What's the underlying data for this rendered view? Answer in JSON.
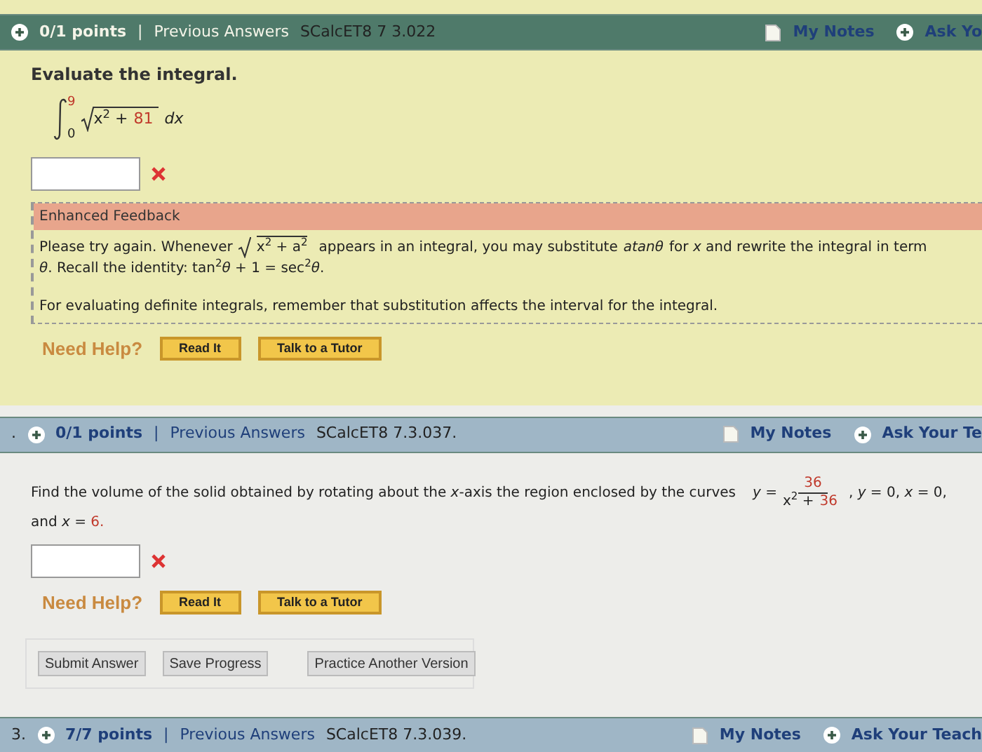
{
  "questions": [
    {
      "header": {
        "points": "0/1 points",
        "separator": "|",
        "previous": "Previous Answers",
        "code": "SCalcET8 7 3.022",
        "notes": "My Notes",
        "ask": "Ask Yo"
      },
      "kind": "feedback",
      "prompt": "Evaluate the integral.",
      "integral": {
        "upper": "9",
        "lower": "0",
        "radicand": [
          {
            "text": "x$^{2}$ +",
            "highlight": false
          },
          {
            "text": "81",
            "highlight": true
          }
        ],
        "differential": "dx"
      },
      "answer": {
        "incorrect": true
      },
      "feedback": {
        "title": "Enhanced Feedback",
        "line1_before": "Please try again. Whenever",
        "radical": "x$^{2}$ + a$^{2}$",
        "line1_mid": "appears in an integral, you may substitute",
        "substitution": "atanθ",
        "line1_after": "for *x* and rewrite the integral in term",
        "line2": "*θ*. Recall the identity: tan$^{2}$*θ* + 1 = sec$^{2}$*θ*.",
        "note": "For evaluating definite integrals, remember that substitution affects the interval for the integral."
      },
      "help": {
        "label": "Need Help?",
        "buttons": [
          "Read It",
          "Talk to a Tutor"
        ]
      }
    },
    {
      "number": ".",
      "header": {
        "points": "0/1 points",
        "separator": "|",
        "previous": "Previous Answers",
        "code": "SCalcET8 7.3.037.",
        "notes": "My Notes",
        "ask": "Ask Your Te"
      },
      "kind": "plain",
      "volume": {
        "text": "Find the volume of the solid obtained by rotating about the *x*-axis the region enclosed by the curves",
        "y": "*y* =",
        "numerator": "36",
        "denominator": [
          {
            "text": "x$^{2}$ +",
            "highlight": false
          },
          {
            "text": "36",
            "highlight": true
          }
        ],
        "rest": ", *y* = 0, *x* = 0,",
        "and": "and *x* =",
        "value": "6."
      },
      "answer": {
        "incorrect": true
      },
      "help": {
        "label": "Need Help?",
        "buttons": [
          "Read It",
          "Talk to a Tutor"
        ]
      },
      "actions": [
        "Submit Answer",
        "Save Progress",
        "Practice Another Version"
      ]
    },
    {
      "number": "3.",
      "header": {
        "points": "7/7 points",
        "separator": "|",
        "previous": "Previous Answers",
        "code": "SCalcET8 7.3.039.",
        "notes": "My Notes",
        "ask": "Ask Your Teach"
      },
      "kind": "plain"
    }
  ]
}
